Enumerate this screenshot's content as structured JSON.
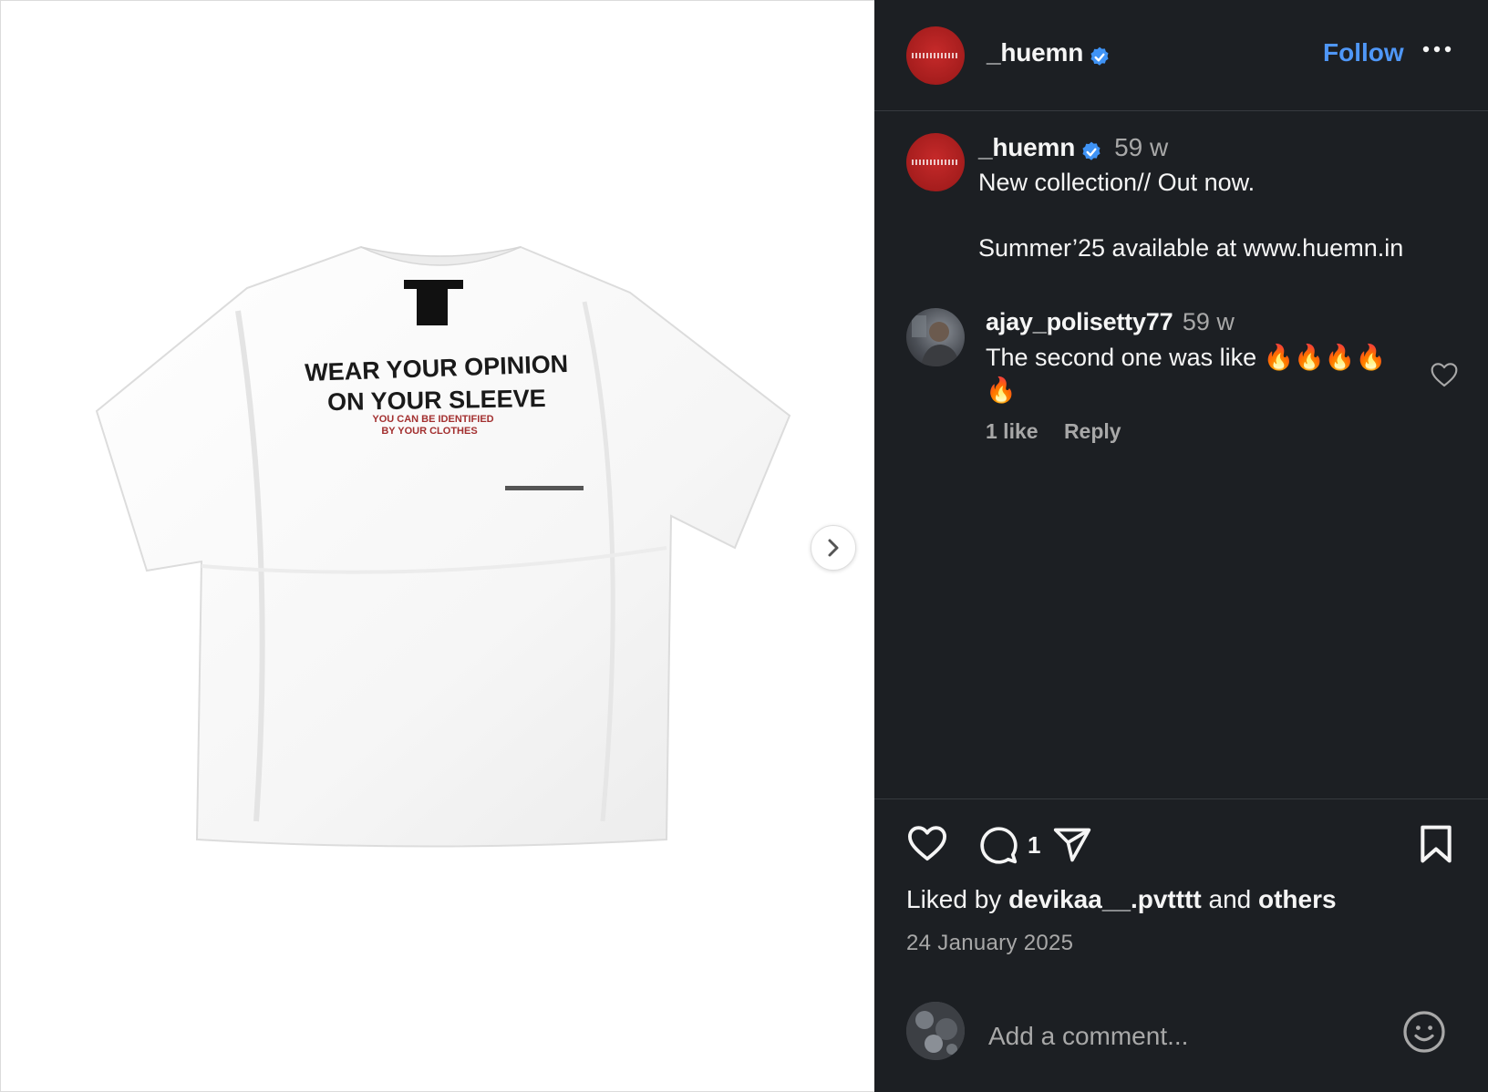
{
  "post": {
    "author": "_huemn",
    "verified": true,
    "follow_label": "Follow",
    "more_icon": "more-options-icon"
  },
  "caption": {
    "author": "_huemn",
    "time": "59 w",
    "line1": "New collection// Out now.",
    "line2": "Summer’25 available at www.huemn.in"
  },
  "comments": [
    {
      "author": "ajay_polisetty77",
      "time": "59 w",
      "text": "The second one was like 🔥🔥🔥🔥🔥",
      "likes": "1 like",
      "reply_label": "Reply"
    }
  ],
  "actions": {
    "comment_count": "1",
    "liked_by_prefix": "Liked by",
    "liked_by_user": "devikaa__.pvtttt",
    "liked_by_and": "and",
    "liked_by_others": "others",
    "date": "24 January 2025"
  },
  "composer": {
    "placeholder": "Add a comment..."
  },
  "shirt_print": {
    "line1": "WEAR YOUR OPINION",
    "line2": "ON YOUR SLEEVE",
    "line3": "YOU CAN BE IDENTIFIED",
    "line4": "BY YOUR CLOTHES"
  },
  "colors": {
    "panel_bg": "#1c1f23",
    "accent_blue": "#4f97f7",
    "brand_red": "#b22222",
    "muted_text": "#a8a8a8"
  }
}
